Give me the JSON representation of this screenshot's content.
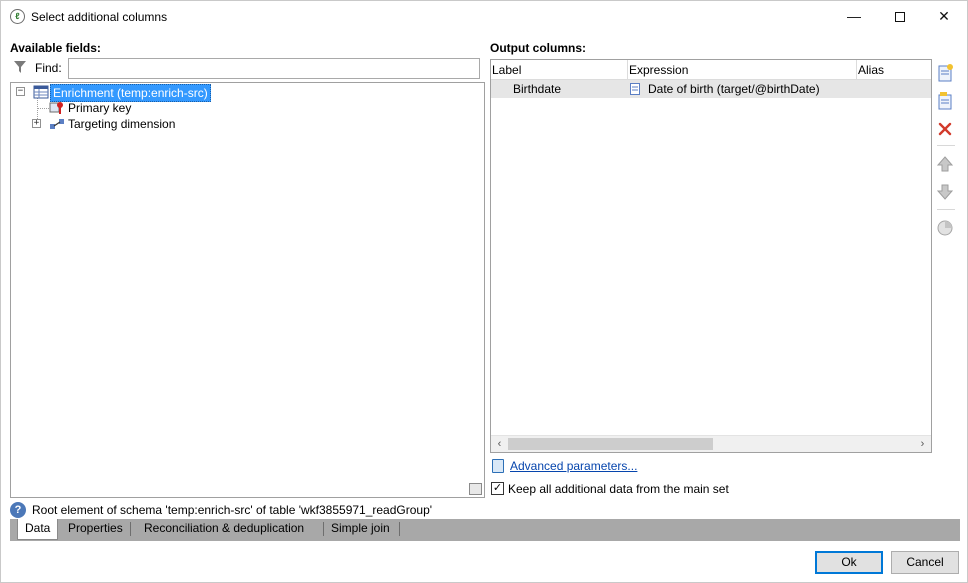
{
  "window": {
    "title": "Select additional columns",
    "app_icon": "adobe-campaign-icon",
    "controls": {
      "minimize": "—",
      "maximize": "",
      "close": "✕"
    }
  },
  "available_fields": {
    "heading": "Available fields:",
    "find_label": "Find:",
    "find_value": "",
    "tree": [
      {
        "label": "Enrichment (temp:enrich-src)",
        "icon": "table-icon",
        "expanded": true,
        "selected": true
      },
      {
        "label": "Primary key",
        "icon": "key-icon"
      },
      {
        "label": "Targeting dimension",
        "icon": "link-icon",
        "expanded": false
      }
    ]
  },
  "output_columns": {
    "heading": "Output columns:",
    "columns": [
      "Label",
      "Expression",
      "Alias"
    ],
    "rows": [
      {
        "label": "Birthdate",
        "expression": "Date of birth (target/@birthDate)",
        "alias": ""
      }
    ],
    "toolbar": [
      {
        "name": "add-column-icon",
        "glyph": "🗋"
      },
      {
        "name": "edit-column-icon",
        "glyph": "🗐"
      },
      {
        "name": "delete-column-icon",
        "glyph": "✕"
      },
      {
        "name": "move-up-icon",
        "glyph": "⇧"
      },
      {
        "name": "move-down-icon",
        "glyph": "⇩"
      },
      {
        "name": "distribution-icon",
        "glyph": "◔"
      }
    ]
  },
  "advanced": {
    "link_text": "Advanced parameters..."
  },
  "keep_data": {
    "label": "Keep all additional data from the main set",
    "checked": true,
    "check_glyph": "✓"
  },
  "status": {
    "icon": "?",
    "text": "Root element of schema 'temp:enrich-src' of table 'wkf3855971_readGroup'"
  },
  "tabs": [
    "Data",
    "Properties",
    "Reconciliation & deduplication",
    "Simple join"
  ],
  "buttons": {
    "ok": "Ok",
    "cancel": "Cancel"
  }
}
